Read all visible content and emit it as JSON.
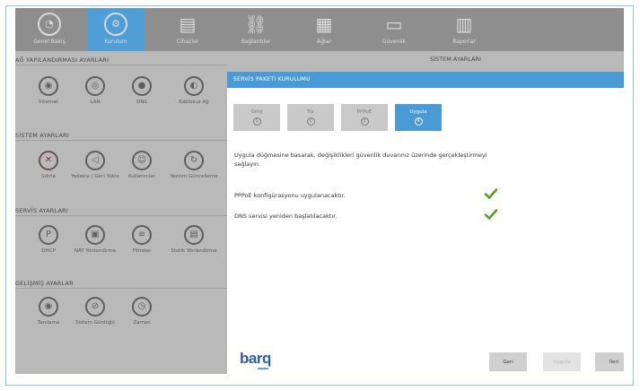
{
  "toolbar": {
    "items": [
      {
        "label": "Genel Bakış",
        "icon": "dashboard-icon"
      },
      {
        "label": "Kurulum",
        "icon": "settings-icon"
      },
      {
        "label": "Cihazlar",
        "icon": "devices-icon"
      },
      {
        "label": "Bağlantılar",
        "icon": "link-icon"
      },
      {
        "label": "Ağlar",
        "icon": "network-icon"
      },
      {
        "label": "Güvenlik",
        "icon": "window-icon"
      },
      {
        "label": "Raporlar",
        "icon": "report-icon"
      }
    ]
  },
  "left_panel": {
    "sections": [
      {
        "title": "AĞ YAPILANDIRMASI AYARLARI",
        "items": [
          {
            "label": "İnternet",
            "icon": "globe-icon"
          },
          {
            "label": "LAN",
            "icon": "lan-icon"
          },
          {
            "label": "DNS",
            "icon": "dns-icon"
          },
          {
            "label": "Kablosuz Ağ",
            "icon": "wireless-icon"
          }
        ]
      },
      {
        "title": "SİSTEM AYARLARI",
        "items": [
          {
            "label": "Sıfırla",
            "icon": "reset-icon"
          },
          {
            "label": "Yedekle / Geri Yükle",
            "icon": "backup-icon"
          },
          {
            "label": "Kullanıcılar",
            "icon": "users-icon"
          },
          {
            "label": "Yazılım Güncelleme",
            "icon": "update-icon"
          }
        ]
      },
      {
        "title": "SERVİS AYARLARI",
        "items": [
          {
            "label": "DHCP",
            "icon": "dhcp-icon"
          },
          {
            "label": "NAT Yönlendirme",
            "icon": "nat-icon"
          },
          {
            "label": "Filtreler",
            "icon": "filter-icon"
          },
          {
            "label": "Statik Yönlendirme",
            "icon": "route-icon"
          }
        ]
      },
      {
        "title": "GELİŞMİŞ AYARLAR",
        "items": [
          {
            "label": "Tanılama",
            "icon": "diagnostics-icon"
          },
          {
            "label": "Sistem Günlüğü",
            "icon": "log-icon"
          },
          {
            "label": "Zaman",
            "icon": "clock-icon"
          }
        ]
      }
    ]
  },
  "right_panel": {
    "title": "SİSTEM AYARLARI"
  },
  "modal": {
    "title": "SERVİS PAKETİ KURULUMU",
    "steps": [
      {
        "name": "Giriş",
        "num": "1"
      },
      {
        "name": "Tür",
        "num": "2"
      },
      {
        "name": "PPPoE",
        "num": "3"
      },
      {
        "name": "Uygula",
        "num": "4"
      }
    ],
    "active_step": "Uygula",
    "description": "Uygula düğmesine basarak, değişiklikleri güvenlik duvarınız üzerinde gerçekleştirmeyi sağlayın.",
    "tasks": [
      {
        "text": "PPPoE konfigürasyonu uygulanacaktır.",
        "done": true
      },
      {
        "text": "DNS servisi yeniden başlatılacaktır.",
        "done": true
      }
    ],
    "logo": "barq",
    "buttons": {
      "back": "Geri",
      "apply": "Uygula",
      "next": "İleri"
    },
    "check_color": "#5aa020",
    "accent": "#4a9ad6"
  }
}
